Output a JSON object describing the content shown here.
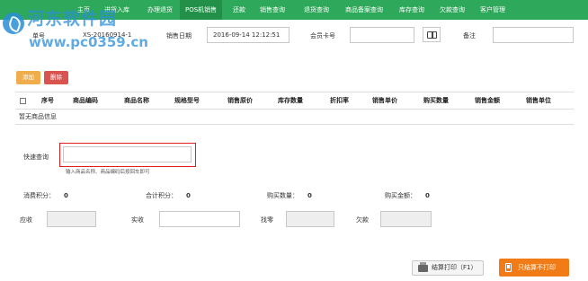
{
  "nav": {
    "items": [
      "主页",
      "进货入库",
      "办理退货",
      "POS机销售",
      "还款",
      "销售查询",
      "退货查询",
      "商品备案查询",
      "库存查询",
      "欠款查询",
      "客户管理"
    ],
    "active_index": 3,
    "color": "#2ea85a"
  },
  "watermark": {
    "title": "河东软件园",
    "url": "www.pc0359.cn"
  },
  "form": {
    "order_label": "单号",
    "order_value": "XS-20160914-1",
    "date_label": "销售日期",
    "date_value": "2016-09-14 12:12:51",
    "member_label": "会员卡号",
    "member_value": "",
    "remark_label": "备注",
    "remark_value": ""
  },
  "toolbar": {
    "add_label": "添加",
    "delete_label": "删除"
  },
  "table": {
    "columns": [
      "序号",
      "商品编码",
      "商品名称",
      "规格型号",
      "销售原价",
      "库存数量",
      "折扣率",
      "销售单价",
      "购买数量",
      "销售金额",
      "销售单位"
    ],
    "empty_text": "暂无商品信息"
  },
  "quick": {
    "label": "快速查询",
    "value": "",
    "hint": "输入商品名称、商品编码后按回车即可"
  },
  "stats": {
    "points_label": "消费积分：",
    "points_value": "0",
    "total_points_label": "合计积分：",
    "total_points_value": "0",
    "qty_label": "购买数量：",
    "qty_value": "0",
    "amount_label": "购买金额：",
    "amount_value": "0"
  },
  "payment": {
    "receivable_label": "应收",
    "receivable_value": "",
    "received_label": "实收",
    "received_value": "",
    "change_label": "找零",
    "change_value": "",
    "debt_label": "欠款",
    "debt_value": ""
  },
  "actions": {
    "print_label": "结算打印（F1）",
    "noprint_label": "只结算不打印"
  },
  "colors": {
    "accent_orange": "#f07b17",
    "add_button": "#f0ad4e",
    "delete_button": "#d9534f",
    "highlight_border": "#e02020"
  }
}
